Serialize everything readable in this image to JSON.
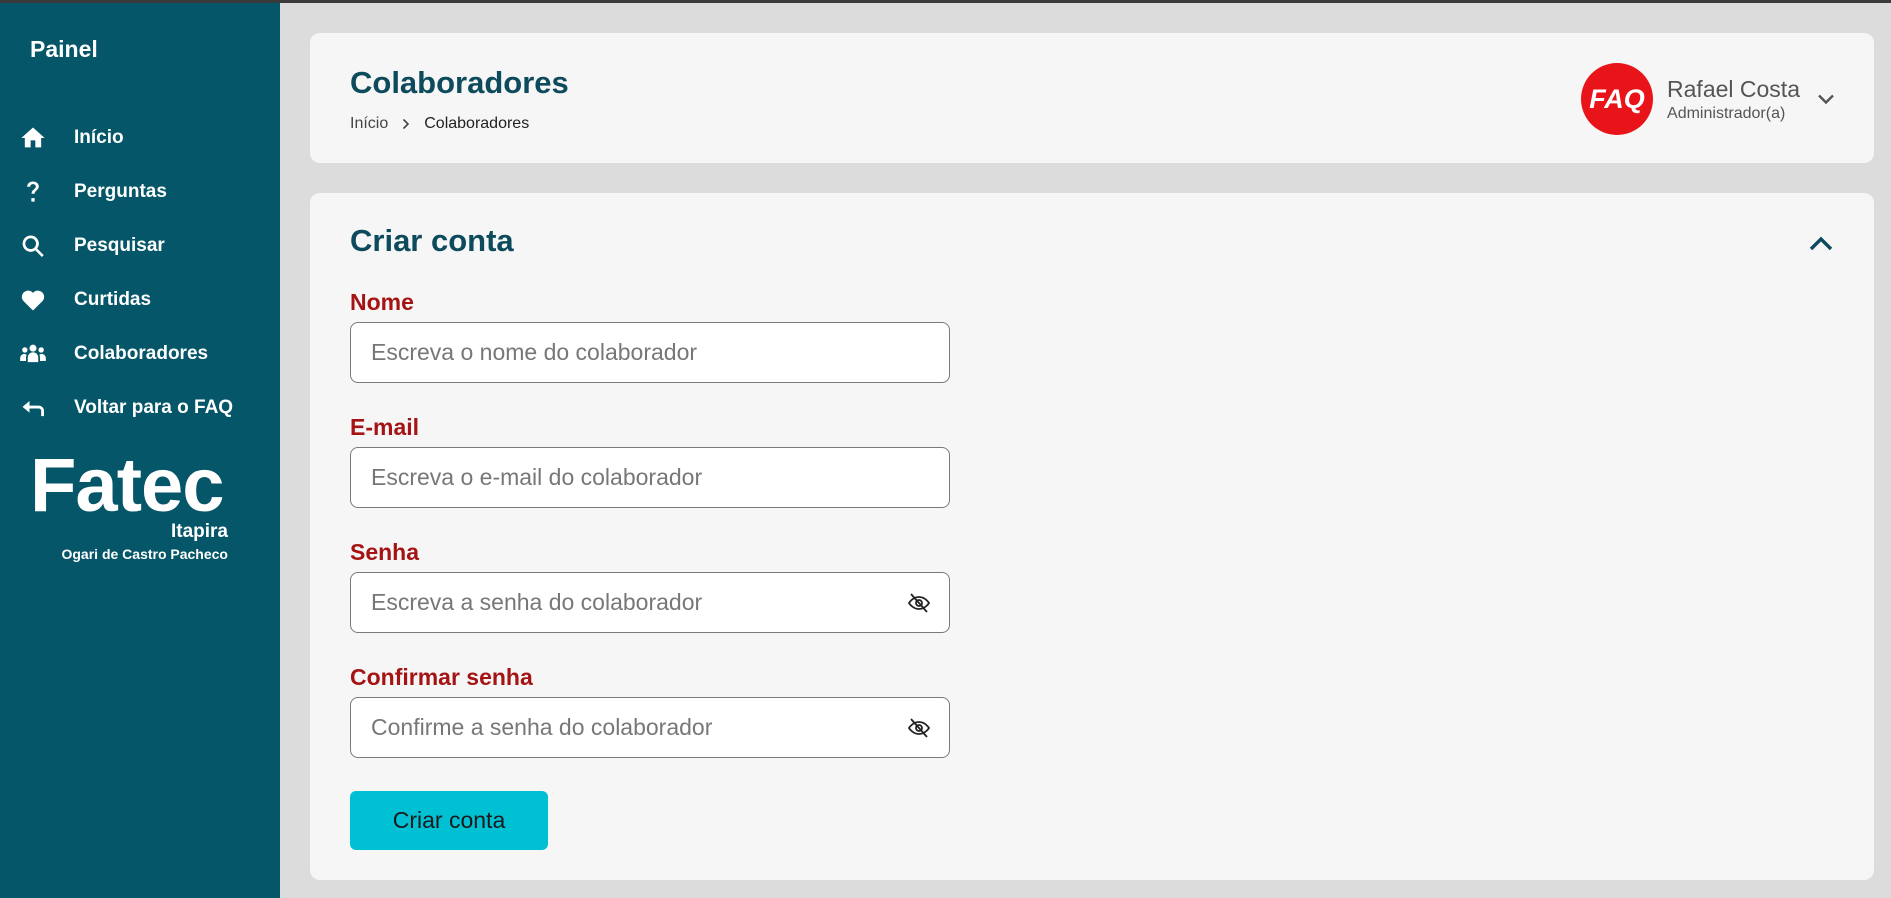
{
  "sidebar": {
    "brand": "Painel",
    "items": [
      {
        "label": "Início",
        "icon": "home-icon"
      },
      {
        "label": "Perguntas",
        "icon": "question-icon"
      },
      {
        "label": "Pesquisar",
        "icon": "search-icon"
      },
      {
        "label": "Curtidas",
        "icon": "heart-icon"
      },
      {
        "label": "Colaboradores",
        "icon": "users-icon"
      },
      {
        "label": "Voltar para o FAQ",
        "icon": "back-arrow-icon"
      }
    ],
    "logo": {
      "main": "Fatec",
      "city": "Itapira",
      "sub": "Ogari de Castro Pacheco"
    }
  },
  "header": {
    "title": "Colaboradores",
    "breadcrumb": {
      "home": "Início",
      "current": "Colaboradores"
    },
    "user": {
      "avatar_text": "FAQ",
      "name": "Rafael Costa",
      "role": "Administrador(a)"
    }
  },
  "form": {
    "title": "Criar conta",
    "fields": [
      {
        "label": "Nome",
        "placeholder": "Escreva o nome do colaborador",
        "value": ""
      },
      {
        "label": "E-mail",
        "placeholder": "Escreva o e-mail do colaborador",
        "value": ""
      },
      {
        "label": "Senha",
        "placeholder": "Escreva a senha do colaborador",
        "value": ""
      },
      {
        "label": "Confirmar senha",
        "placeholder": "Confirme a senha do colaborador",
        "value": ""
      }
    ],
    "submit_label": "Criar conta"
  },
  "colors": {
    "sidebar_bg": "#055668",
    "title_color": "#0c4a5c",
    "label_color": "#a51414",
    "button_bg": "#00c0d4",
    "avatar_bg": "#e8141a"
  }
}
